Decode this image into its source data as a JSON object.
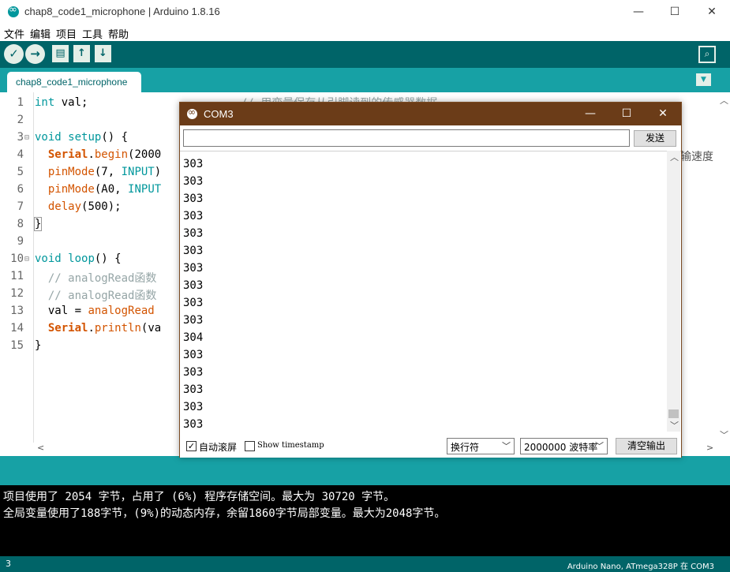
{
  "window": {
    "title": "chap8_code1_microphone | Arduino 1.8.16",
    "minimize": "—",
    "maximize": "☐",
    "close": "✕"
  },
  "menu": [
    "文件",
    "编辑",
    "项目",
    "工具",
    "帮助"
  ],
  "toolbar": {
    "verify_icon": "✓",
    "upload_icon": "→",
    "new_icon": "▤",
    "open_icon": "↑",
    "save_icon": "↓",
    "serial_icon": "⌕"
  },
  "tabs": {
    "active": "chap8_code1_microphone",
    "menu_icon": "▼"
  },
  "editor": {
    "line_numbers": [
      "1",
      "2",
      "3",
      "4",
      "5",
      "6",
      "7",
      "8",
      "9",
      "10",
      "11",
      "12",
      "13",
      "14",
      "15"
    ],
    "lines": [
      "int val;",
      "",
      "void setup() {",
      "  Serial.begin(2000",
      "  pinMode(7, INPUT)",
      "  pinMode(A0, INPUT",
      "  delay(500);",
      "}",
      "",
      "void loop() {",
      "  // analogRead函数",
      "  // analogRead函数",
      "  val = analogRead",
      "  Serial.println(va",
      "}"
    ],
    "hidden_comment_1": "// 用变量保存从引脚读到的传感器数据",
    "hidden_comment_2": "输速度"
  },
  "console": {
    "line1": "项目使用了 2054 字节，占用了 (6%) 程序存储空间。最大为 30720 字节。",
    "line2": "全局变量使用了188字节，(9%)的动态内存，余留1860字节局部变量。最大为2048字节。"
  },
  "status": {
    "line": "3",
    "board": "Arduino Nano, ATmega328P 在 COM3"
  },
  "serial_monitor": {
    "title": "COM3",
    "input_value": "",
    "send_label": "发送",
    "output": [
      "303",
      "303",
      "303",
      "303",
      "303",
      "303",
      "303",
      "303",
      "303",
      "303",
      "304",
      "303",
      "303",
      "303",
      "303",
      "303"
    ],
    "autoscroll_label": "自动滚屏",
    "autoscroll_checked": "✓",
    "timestamp_label": "Show timestamp",
    "line_ending": "换行符",
    "baud_rate": "2000000 波特率",
    "clear_label": "清空输出"
  },
  "colors": {
    "toolbar": "#006468",
    "tabbar": "#17a1a5",
    "serial_title": "#6b3c18",
    "keyword": "#00979c",
    "function": "#d35400"
  }
}
